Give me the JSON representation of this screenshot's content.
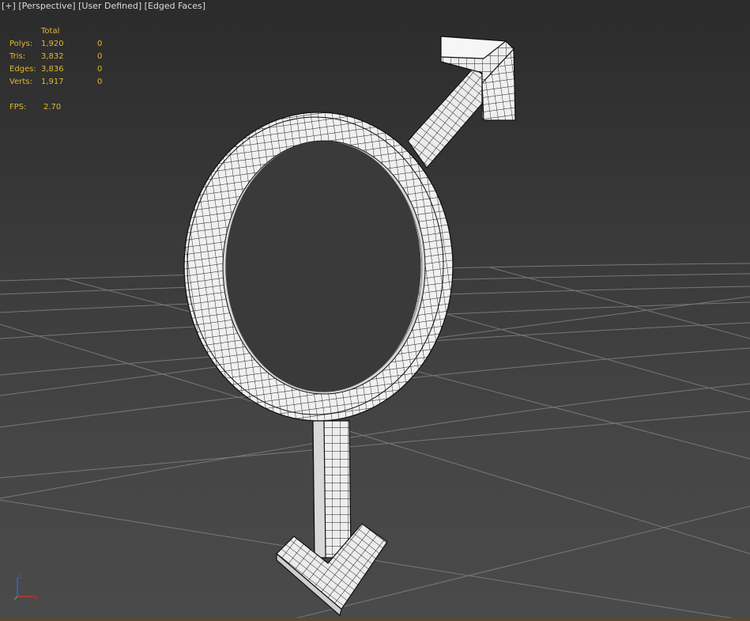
{
  "viewport": {
    "labels": [
      "[+]",
      "[Perspective]",
      "[User Defined]",
      "[Edged Faces]"
    ]
  },
  "stats": {
    "header": "Total",
    "rows": [
      {
        "label": "Polys:",
        "total": "1,920",
        "selected": "0"
      },
      {
        "label": "Tris:",
        "total": "3,832",
        "selected": "0"
      },
      {
        "label": "Edges:",
        "total": "3,836",
        "selected": "0"
      },
      {
        "label": "Verts:",
        "total": "1,917",
        "selected": "0"
      }
    ],
    "fps_label": "FPS:",
    "fps_value": "2.70"
  },
  "axis": {
    "z": "z",
    "x": "x"
  },
  "colors": {
    "stats_text": "#e0b830",
    "label_text": "#dcdcdc",
    "mesh_fill": "#f2f2f2",
    "mesh_edge": "#111111",
    "grid": "#8a8a8a",
    "axis_x": "#d03030",
    "axis_y": "#30b030",
    "axis_z": "#3060e0"
  }
}
